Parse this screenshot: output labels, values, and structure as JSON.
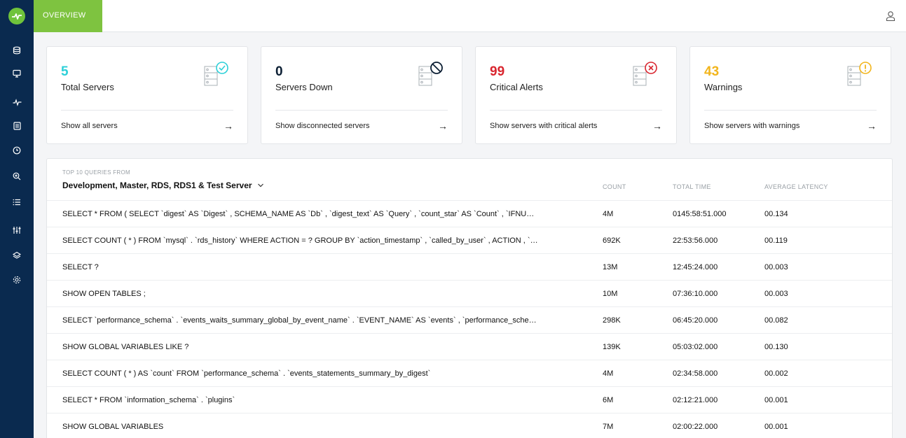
{
  "topbar": {
    "tab_label": "OVERVIEW"
  },
  "sidebar": {
    "icons": [
      "database-icon",
      "monitor-icon",
      "pulse-icon",
      "document-icon",
      "clock-icon",
      "zoom-icon",
      "list-icon",
      "sliders-icon",
      "layers-icon",
      "settings-icon"
    ]
  },
  "cards": [
    {
      "value": "5",
      "label": "Total Servers",
      "link": "Show all servers",
      "color": "#2dd0d8",
      "badge": "check"
    },
    {
      "value": "0",
      "label": "Servers Down",
      "link": "Show disconnected servers",
      "color": "#0b1e33",
      "badge": "block"
    },
    {
      "value": "99",
      "label": "Critical Alerts",
      "link": "Show servers with critical alerts",
      "color": "#d9262f",
      "badge": "x"
    },
    {
      "value": "43",
      "label": "Warnings",
      "link": "Show servers with warnings",
      "color": "#f2b51c",
      "badge": "warn"
    }
  ],
  "queries": {
    "subtitle": "TOP 10 QUERIES FROM",
    "title": "Development, Master, RDS, RDS1 & Test Server",
    "columns": {
      "count": "COUNT",
      "time": "TOTAL TIME",
      "latency": "AVERAGE LATENCY"
    },
    "rows": [
      {
        "query": "SELECT * FROM ( SELECT `digest` AS `Digest` , SCHEMA_NAME AS `Db` , `digest_text` AS `Query` , `count_star` AS `Count` , `IFNU…",
        "count": "4M",
        "time": "0145:58:51.000",
        "latency": "00.134"
      },
      {
        "query": "SELECT COUNT ( * ) FROM `mysql` . `rds_history` WHERE ACTION = ? GROUP BY `action_timestamp` , `called_by_user` , ACTION , `…",
        "count": "692K",
        "time": "22:53:56.000",
        "latency": "00.119"
      },
      {
        "query": "SELECT ?",
        "count": "13M",
        "time": "12:45:24.000",
        "latency": "00.003"
      },
      {
        "query": "SHOW OPEN TABLES ;",
        "count": "10M",
        "time": "07:36:10.000",
        "latency": "00.003"
      },
      {
        "query": "SELECT `performance_schema` . `events_waits_summary_global_by_event_name` . `EVENT_NAME` AS `events` , `performance_sche…",
        "count": "298K",
        "time": "06:45:20.000",
        "latency": "00.082"
      },
      {
        "query": "SHOW GLOBAL VARIABLES LIKE ?",
        "count": "139K",
        "time": "05:03:02.000",
        "latency": "00.130"
      },
      {
        "query": "SELECT COUNT ( * ) AS `count` FROM `performance_schema` . `events_statements_summary_by_digest`",
        "count": "4M",
        "time": "02:34:58.000",
        "latency": "00.002"
      },
      {
        "query": "SELECT * FROM `information_schema` . `plugins`",
        "count": "6M",
        "time": "02:12:21.000",
        "latency": "00.001"
      },
      {
        "query": "SHOW GLOBAL VARIABLES",
        "count": "7M",
        "time": "02:00:22.000",
        "latency": "00.001"
      }
    ]
  }
}
